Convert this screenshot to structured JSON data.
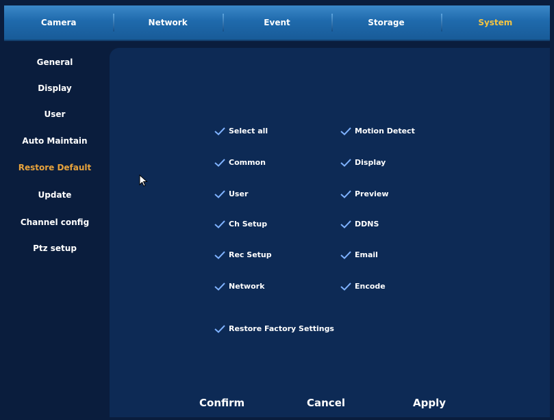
{
  "tabs": [
    {
      "label": "Camera",
      "active": false
    },
    {
      "label": "Network",
      "active": false
    },
    {
      "label": "Event",
      "active": false
    },
    {
      "label": "Storage",
      "active": false
    },
    {
      "label": "System",
      "active": true
    }
  ],
  "sidebar": {
    "items": [
      {
        "label": "General",
        "active": false
      },
      {
        "label": "Display",
        "active": false
      },
      {
        "label": "User",
        "active": false
      },
      {
        "label": "Auto Maintain",
        "active": false
      },
      {
        "label": "Restore Default",
        "active": true
      },
      {
        "label": "Update",
        "active": false
      },
      {
        "label": "Channel config",
        "active": false
      },
      {
        "label": "Ptz setup",
        "active": false
      }
    ]
  },
  "restore": {
    "left": [
      {
        "label": "Select all",
        "checked": true
      },
      {
        "label": "Common",
        "checked": true
      },
      {
        "label": "User",
        "checked": true
      },
      {
        "label": "Ch Setup",
        "checked": true
      },
      {
        "label": "Rec Setup",
        "checked": true
      },
      {
        "label": "Network",
        "checked": true
      }
    ],
    "right": [
      {
        "label": "Motion Detect",
        "checked": true
      },
      {
        "label": "Display",
        "checked": true
      },
      {
        "label": "Preview",
        "checked": true
      },
      {
        "label": "DDNS",
        "checked": true
      },
      {
        "label": "Email",
        "checked": true
      },
      {
        "label": "Encode",
        "checked": true
      }
    ],
    "factory": {
      "label": "Restore Factory Settings",
      "checked": true
    }
  },
  "buttons": {
    "confirm": "Confirm",
    "cancel": "Cancel",
    "apply": "Apply"
  },
  "colors": {
    "background": "#0a1d3d",
    "panel": "#0d2a55",
    "tab_active": "#f5c542",
    "sidebar_active": "#e8a33c",
    "check": "#7fb2ff"
  }
}
